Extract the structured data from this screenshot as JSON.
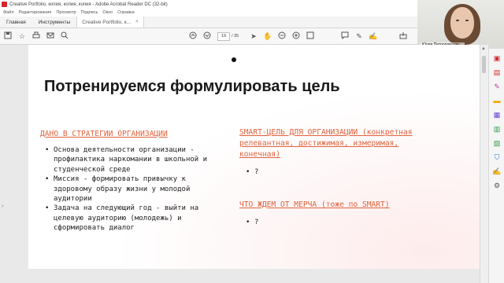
{
  "window": {
    "title": "Creative Portfolio, копия, копия, копия - Adobe Acrobat Reader DC (32-bit)"
  },
  "menu": [
    "Файл",
    "Редактирование",
    "Просмотр",
    "Подпись",
    "Окно",
    "Справка"
  ],
  "tabs": {
    "home": "Главная",
    "tools": "Инструменты",
    "document": "Creative Portfolio, к...",
    "close_glyph": "×"
  },
  "toolbar": {
    "current_page": "19",
    "total_pages": "/ 35",
    "icons": [
      "save-icon",
      "bookmark-icon",
      "print-icon",
      "email-icon",
      "search-icon",
      "page-up-icon",
      "page-down-icon",
      "cursor-icon",
      "hand-icon",
      "zoom-out-icon",
      "zoom-in-icon",
      "fit-page-icon",
      "comment-icon",
      "highlight-icon",
      "sign-icon",
      "share-icon"
    ]
  },
  "webcam": {
    "participant_name": "Юлия Петропавловс..."
  },
  "slide": {
    "title": "Потренируемся формулировать цель",
    "left_heading": "ДАНО В СТРАТЕГИИ ОРГАНИЗАЦИИ",
    "left_bullets": [
      "Основа деятельности организации - профилактика наркомании в школьной и студенческой среде",
      "Миссия - формировать привычку к здоровому образу жизни у молодой аудитории",
      "Задача на следующий год - выйти на целевую аудиторию (молодежь) и сформировать диалог"
    ],
    "right_heading": "SMART-ЦЕЛЬ ДЛЯ ОРГАНИЗАЦИИ (конкретная релевантная, достижимая, измеримая, конечная)",
    "right_bullets": [
      "?"
    ],
    "right_heading_2": "ЧТО ЖДЕМ ОТ МЕРЧА (тоже по SMART)",
    "right_bullets_2": [
      "?"
    ]
  },
  "colors": {
    "accent": "#e2633d",
    "acrobat_red": "#d6262c"
  },
  "right_panel_icons": [
    "pdf-export-icon",
    "create-pdf-icon",
    "edit-pdf-icon",
    "comment-tool-icon",
    "combine-icon",
    "organize-icon",
    "scan-icon",
    "protect-icon",
    "fill-sign-icon",
    "more-tools-icon"
  ]
}
